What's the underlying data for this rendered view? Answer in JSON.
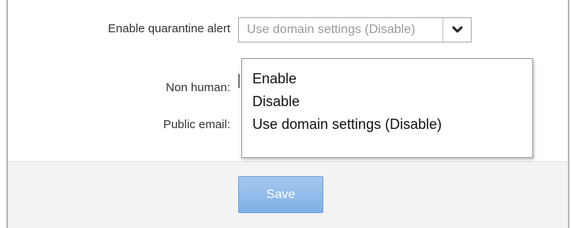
{
  "form": {
    "quarantine_alert_label": "Enable quarantine alert",
    "non_human_label": "Non human:",
    "public_email_label": "Public email:",
    "quarantine_alert_select": {
      "value": "Use domain settings (Disable)",
      "options": [
        "Enable",
        "Disable",
        "Use domain settings (Disable)"
      ]
    },
    "save_label": "Save"
  },
  "icons": {
    "dropdown_arrow": "chevron-down-icon"
  },
  "colors": {
    "save_button": "#8fbcea",
    "footer_band": "#f3f3f3"
  }
}
